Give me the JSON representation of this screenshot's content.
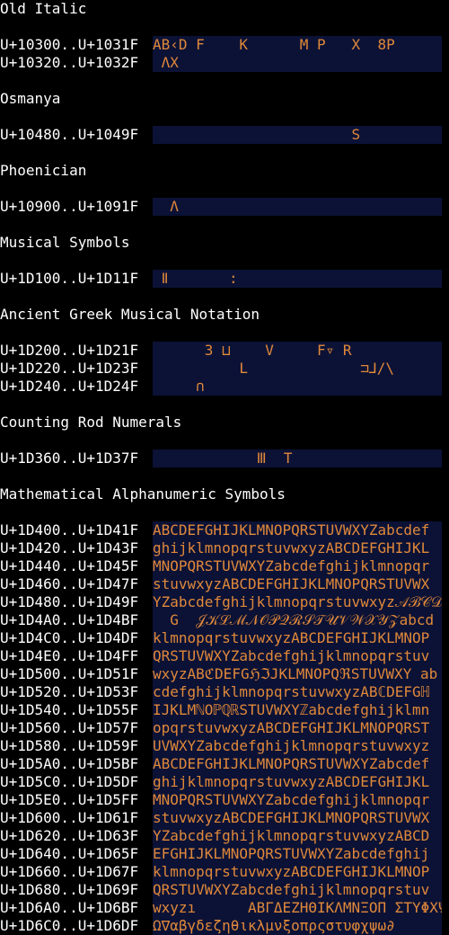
{
  "colors": {
    "background": "#000000",
    "label_text": "#ffffff",
    "glyph_text": "#e0883a",
    "glyph_cell": "#0b1236"
  },
  "sections": [
    {
      "title": "Old Italic",
      "rows": [
        {
          "range": "U+10300..U+1031F",
          "glyphs": "AB‹D F    K      M P   X  8P"
        },
        {
          "range": "U+10320..U+1032F",
          "glyphs": " ΛX"
        }
      ]
    },
    {
      "title": "Osmanya",
      "rows": [
        {
          "range": "U+10480..U+1049F",
          "glyphs": "                       S"
        }
      ]
    },
    {
      "title": "Phoenician",
      "rows": [
        {
          "range": "U+10900..U+1091F",
          "glyphs": "  Λ"
        }
      ]
    },
    {
      "title": "Musical Symbols",
      "rows": [
        {
          "range": "U+1D100..U+1D11F",
          "glyphs": " Ⅱ       :"
        }
      ]
    },
    {
      "title": "Ancient Greek Musical Notation",
      "rows": [
        {
          "range": "U+1D200..U+1D21F",
          "glyphs": "      3 ⊔    V     F▿ R"
        },
        {
          "range": "U+1D220..U+1D23F",
          "glyphs": "          L             ⊐⅃/\\"
        },
        {
          "range": "U+1D240..U+1D24F",
          "glyphs": "     ∩"
        }
      ]
    },
    {
      "title": "Counting Rod Numerals",
      "rows": [
        {
          "range": "U+1D360..U+1D37F",
          "glyphs": "            Ⅲ  T"
        }
      ]
    },
    {
      "title": "Mathematical Alphanumeric Symbols",
      "rows": [
        {
          "range": "U+1D400..U+1D41F",
          "glyphs": "ABCDEFGHIJKLMNOPQRSTUVWXYZabcdef"
        },
        {
          "range": "U+1D420..U+1D43F",
          "glyphs": "ghijklmnopqrstuvwxyzABCDEFGHIJKL"
        },
        {
          "range": "U+1D440..U+1D45F",
          "glyphs": "MNOPQRSTUVWXYZabcdefghijklmnopqr"
        },
        {
          "range": "U+1D460..U+1D47F",
          "glyphs": "stuvwxyzABCDEFGHIJKLMNOPQRSTUVWX"
        },
        {
          "range": "U+1D480..U+1D49F",
          "glyphs": "YZabcdefghijklmnopqrstuvwxyz𝒜ℬ𝒞𝒟"
        },
        {
          "range": "U+1D4A0..U+1D4BF",
          "glyphs": "  G  𝒥𝒦ℒℳ𝒩𝒪𝒫𝒬ℛ𝒮𝒯𝒰𝒱𝒲𝒳𝒴𝒵abcd f ghij"
        },
        {
          "range": "U+1D4C0..U+1D4DF",
          "glyphs": "klmnopqrstuvwxyzABCDEFGHIJKLMNOP"
        },
        {
          "range": "U+1D4E0..U+1D4FF",
          "glyphs": "QRSTUVWXYZabcdefghijklmnopqrstuv"
        },
        {
          "range": "U+1D500..U+1D51F",
          "glyphs": "wxyzABℭDEFGℌℑJKLMNOPQℜSTUVWXY ab"
        },
        {
          "range": "U+1D520..U+1D53F",
          "glyphs": "cdefghijklmnopqrstuvwxyzABℂDEFGℍ"
        },
        {
          "range": "U+1D540..U+1D55F",
          "glyphs": "IJKLMℕOℙℚℝSTUVWXYℤabcdefghijklmn"
        },
        {
          "range": "U+1D560..U+1D57F",
          "glyphs": "opqrstuvwxyzABCDEFGHIJKLMNOPQRST"
        },
        {
          "range": "U+1D580..U+1D59F",
          "glyphs": "UVWXYZabcdefghijklmnopqrstuvwxyz"
        },
        {
          "range": "U+1D5A0..U+1D5BF",
          "glyphs": "ABCDEFGHIJKLMNOPQRSTUVWXYZabcdef"
        },
        {
          "range": "U+1D5C0..U+1D5DF",
          "glyphs": "ghijklmnopqrstuvwxyzABCDEFGHIJKL"
        },
        {
          "range": "U+1D5E0..U+1D5FF",
          "glyphs": "MNOPQRSTUVWXYZabcdefghijklmnopqr"
        },
        {
          "range": "U+1D600..U+1D61F",
          "glyphs": "stuvwxyzABCDEFGHIJKLMNOPQRSTUVWX"
        },
        {
          "range": "U+1D620..U+1D63F",
          "glyphs": "YZabcdefghijklmnopqrstuvwxyzABCD"
        },
        {
          "range": "U+1D640..U+1D65F",
          "glyphs": "EFGHIJKLMNOPQRSTUVWXYZabcdefghij"
        },
        {
          "range": "U+1D660..U+1D67F",
          "glyphs": "klmnopqrstuvwxyzABCDEFGHIJKLMNOP"
        },
        {
          "range": "U+1D680..U+1D69F",
          "glyphs": "QRSTUVWXYZabcdefghijklmnopqrstuv"
        },
        {
          "range": "U+1D6A0..U+1D6BF",
          "glyphs": "wxyzı      ΑΒΓΔΕΖΗΘΙΚΛΜΝΞΟΠ ΣΤΥΦΧΨ"
        },
        {
          "range": "U+1D6C0..U+1D6DF",
          "glyphs": "Ω∇αβγδεζηθικλμνξοπρςστυφχψω∂"
        }
      ]
    }
  ]
}
